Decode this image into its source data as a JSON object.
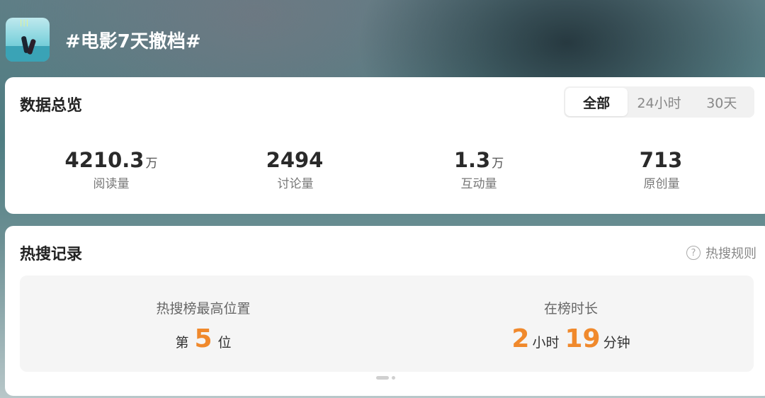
{
  "topic": {
    "title": "#电影7天撤档#",
    "thumbnail_icon": "movie-poster-thumbnail"
  },
  "overview": {
    "title": "数据总览",
    "tabs": [
      {
        "label": "全部",
        "active": true
      },
      {
        "label": "24小时",
        "active": false
      },
      {
        "label": "30天",
        "active": false
      }
    ],
    "stats": [
      {
        "value": "4210.3",
        "unit": "万",
        "label": "阅读量"
      },
      {
        "value": "2494",
        "unit": "",
        "label": "讨论量"
      },
      {
        "value": "1.3",
        "unit": "万",
        "label": "互动量"
      },
      {
        "value": "713",
        "unit": "",
        "label": "原创量"
      }
    ]
  },
  "hot_search": {
    "title": "热搜记录",
    "rules_label": "热搜规则",
    "rules_icon": "question-circle-icon",
    "peak": {
      "caption": "热搜榜最高位置",
      "prefix": "第",
      "rank": "5",
      "suffix": "位"
    },
    "duration": {
      "caption": "在榜时长",
      "hours": "2",
      "hours_unit": "小时",
      "minutes": "19",
      "minutes_unit": "分钟"
    }
  },
  "colors": {
    "accent_orange": "#f0892c",
    "card_bg": "#ffffff",
    "panel_bg": "#f5f5f5"
  }
}
